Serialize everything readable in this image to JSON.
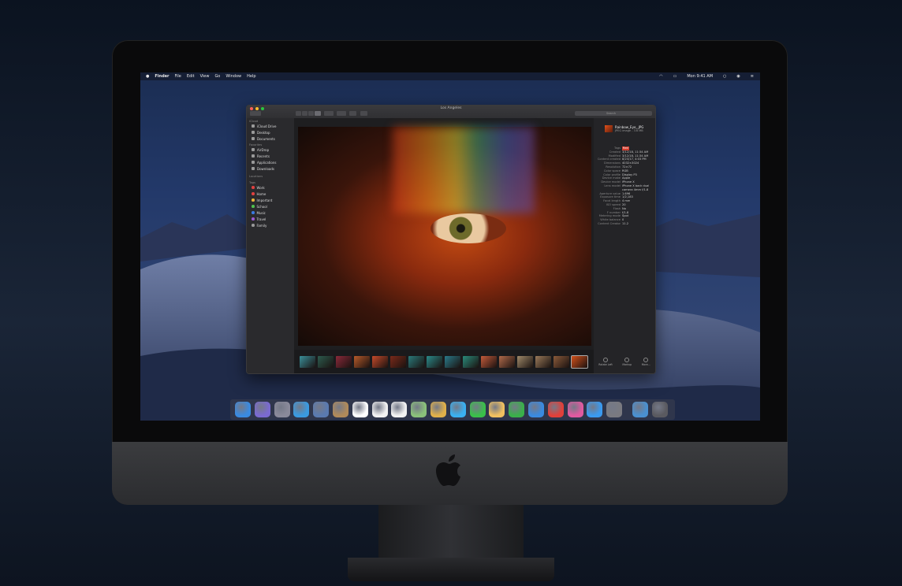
{
  "menubar": {
    "apple": "",
    "app": "Finder",
    "menus": [
      "File",
      "Edit",
      "View",
      "Go",
      "Window",
      "Help"
    ],
    "clock": "Mon 9:41 AM"
  },
  "window": {
    "title": "Los Angeles",
    "search_placeholder": "Search",
    "sidebar": {
      "icloud": {
        "label": "iCloud",
        "items": [
          "iCloud Drive",
          "Desktop",
          "Documents"
        ]
      },
      "favorites": {
        "label": "Favorites",
        "items": [
          "AirDrop",
          "Recents",
          "Applications",
          "Downloads"
        ]
      },
      "locations": {
        "label": "Locations"
      },
      "tags": {
        "label": "Tags",
        "items": [
          {
            "name": "Work",
            "color": "#e04040"
          },
          {
            "name": "Home",
            "color": "#e04040"
          },
          {
            "name": "Important",
            "color": "#e9b43a"
          },
          {
            "name": "School",
            "color": "#4fbf4f"
          },
          {
            "name": "Music",
            "color": "#3a7ae0"
          },
          {
            "name": "Travel",
            "color": "#9b59d0"
          },
          {
            "name": "Family",
            "color": "#999999"
          }
        ]
      }
    },
    "inspector": {
      "file_name": "Rainbow_Eye_.JPG",
      "file_info": "JPEG image - 3.6 MB",
      "metadata": [
        {
          "k": "Tags",
          "v": "Red"
        },
        {
          "k": "Created",
          "v": "3/12/18, 11:34 AM"
        },
        {
          "k": "Modified",
          "v": "3/12/18, 11:34 AM"
        },
        {
          "k": "Content created",
          "v": "8/23/17, 4:03 PM"
        },
        {
          "k": "Dimensions",
          "v": "4032×3024"
        },
        {
          "k": "Resolution",
          "v": "72×72"
        },
        {
          "k": "Color space",
          "v": "RGB"
        },
        {
          "k": "Color profile",
          "v": "Display P3"
        },
        {
          "k": "Device make",
          "v": "Apple"
        },
        {
          "k": "Device model",
          "v": "iPhone X"
        },
        {
          "k": "Lens model",
          "v": "iPhone X back dual"
        },
        {
          "k": "",
          "v": "camera 4mm f/1.8"
        },
        {
          "k": "Aperture value",
          "v": "1.696"
        },
        {
          "k": "Exposure time",
          "v": "1/2,183"
        },
        {
          "k": "Focal length",
          "v": "4 mm"
        },
        {
          "k": "ISO speed",
          "v": "20"
        },
        {
          "k": "Flash",
          "v": "No"
        },
        {
          "k": "F number",
          "v": "f/1.8"
        },
        {
          "k": "Metering mode",
          "v": "Spot"
        },
        {
          "k": "White balance",
          "v": "0"
        },
        {
          "k": "Content Creator",
          "v": "11.2"
        }
      ],
      "actions": [
        "Rotate Left",
        "Markup",
        "More..."
      ]
    }
  },
  "thumb_colors": [
    "#3a8f9a",
    "#2d5b4e",
    "#8a2a3a",
    "#b65a2a",
    "#c44a2a",
    "#7a2a1a",
    "#2a7a7a",
    "#2a8a8a",
    "#2a7a8a",
    "#2a8a7a",
    "#c25a3a",
    "#b06a4a",
    "#a08a6a",
    "#9a7a5a",
    "#8a5a3a",
    "#d2501a"
  ],
  "dock_colors": [
    "#3a8ae0",
    "#7a6ad0",
    "#8a8a9a",
    "#3a9ae0",
    "#5a7ab0",
    "#b08a5a",
    "#ffffff",
    "#f2f2f2",
    "#f2f2f2",
    "#8ac07a",
    "#e0b04a",
    "#3ab0f0",
    "#3ac04a",
    "#f0c060",
    "#3ab04a",
    "#3a8ae0",
    "#e0403a",
    "#e05aa0",
    "#3a9af0",
    "#7a7a80",
    "#4a90d0",
    "#5a5a60"
  ]
}
